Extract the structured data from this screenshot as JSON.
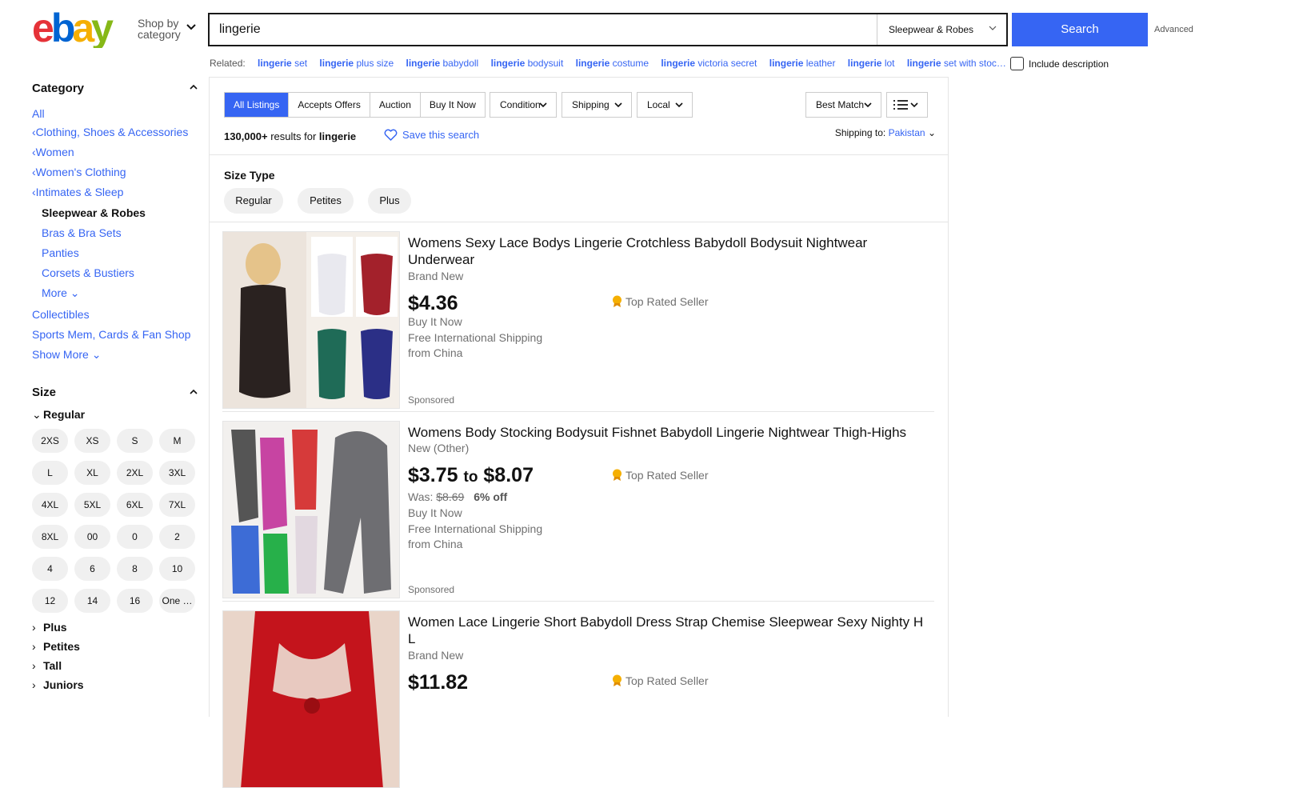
{
  "header": {
    "shop_by": "Shop by",
    "category": "category",
    "search_value": "lingerie",
    "search_category": "Sleepwear & Robes",
    "search_button": "Search",
    "advanced": "Advanced"
  },
  "related": {
    "label": "Related:",
    "items": [
      {
        "bold": "lingerie",
        "rest": " set"
      },
      {
        "bold": "lingerie",
        "rest": " plus size"
      },
      {
        "bold": "lingerie",
        "rest": " babydoll"
      },
      {
        "bold": "lingerie",
        "rest": " bodysuit"
      },
      {
        "bold": "lingerie",
        "rest": " costume"
      },
      {
        "bold": "lingerie",
        "rest": " victoria secret"
      },
      {
        "bold": "lingerie",
        "rest": " leather"
      },
      {
        "bold": "lingerie",
        "rest": " lot"
      },
      {
        "bold": "lingerie",
        "rest": " set with stoc…"
      }
    ],
    "include_description": "Include description"
  },
  "sidebar": {
    "category_heading": "Category",
    "all": "All",
    "clothing": "Clothing, Shoes & Accessories",
    "women": "Women",
    "womens_clothing": "Women's Clothing",
    "intimates": "Intimates & Sleep",
    "current": "Sleepwear & Robes",
    "bras": "Bras & Bra Sets",
    "panties": "Panties",
    "corsets": "Corsets & Bustiers",
    "more": "More",
    "collectibles": "Collectibles",
    "sports": "Sports Mem, Cards & Fan Shop",
    "show_more": "Show More",
    "size_heading": "Size",
    "regular": "Regular",
    "sizes": [
      "2XS",
      "XS",
      "S",
      "M",
      "L",
      "XL",
      "2XL",
      "3XL",
      "4XL",
      "5XL",
      "6XL",
      "7XL",
      "8XL",
      "00",
      "0",
      "2",
      "4",
      "6",
      "8",
      "10",
      "12",
      "14",
      "16",
      "One …"
    ],
    "plus": "Plus",
    "petites": "Petites",
    "tall": "Tall",
    "juniors": "Juniors"
  },
  "toolbar": {
    "tabs": [
      "All Listings",
      "Accepts Offers",
      "Auction",
      "Buy It Now"
    ],
    "condition": "Condition",
    "shipping": "Shipping",
    "local": "Local",
    "sort": "Best Match",
    "results_count": "130,000+",
    "results_for": "results for",
    "results_query": "lingerie",
    "save_search": "Save this search",
    "shipping_to": "Shipping to:",
    "shipping_country": "Pakistan"
  },
  "size_type": {
    "label": "Size Type",
    "chips": [
      "Regular",
      "Petites",
      "Plus"
    ]
  },
  "listings": [
    {
      "title": "Womens Sexy Lace Bodys Lingerie Crotchless Babydoll Bodysuit Nightwear Underwear",
      "condition": "Brand New",
      "price_low": "$4.36",
      "buy_format": "Buy It Now",
      "shipping": "Free International Shipping",
      "from": "from China",
      "top_rated": "Top Rated Seller",
      "sponsored": "Sponsored"
    },
    {
      "title": "Womens Body Stocking Bodysuit Fishnet Babydoll Lingerie Nightwear Thigh-Highs",
      "condition": "New (Other)",
      "price_low": "$3.75",
      "price_to": "to",
      "price_high": "$8.07",
      "was_label": "Was:",
      "was_price": "$8.69",
      "discount": "6% off",
      "buy_format": "Buy It Now",
      "shipping": "Free International Shipping",
      "from": "from China",
      "top_rated": "Top Rated Seller",
      "sponsored": "Sponsored"
    },
    {
      "title": "Women Lace Lingerie Short Babydoll Dress Strap Chemise Sleepwear Sexy Nighty H L",
      "condition": "Brand New",
      "price_low": "$11.82",
      "top_rated": "Top Rated Seller"
    }
  ],
  "colors": {
    "accent": "#3665f3",
    "logo_e": "#e53238",
    "logo_b": "#0064d2",
    "logo_a": "#f5af02",
    "logo_y": "#86b817"
  }
}
